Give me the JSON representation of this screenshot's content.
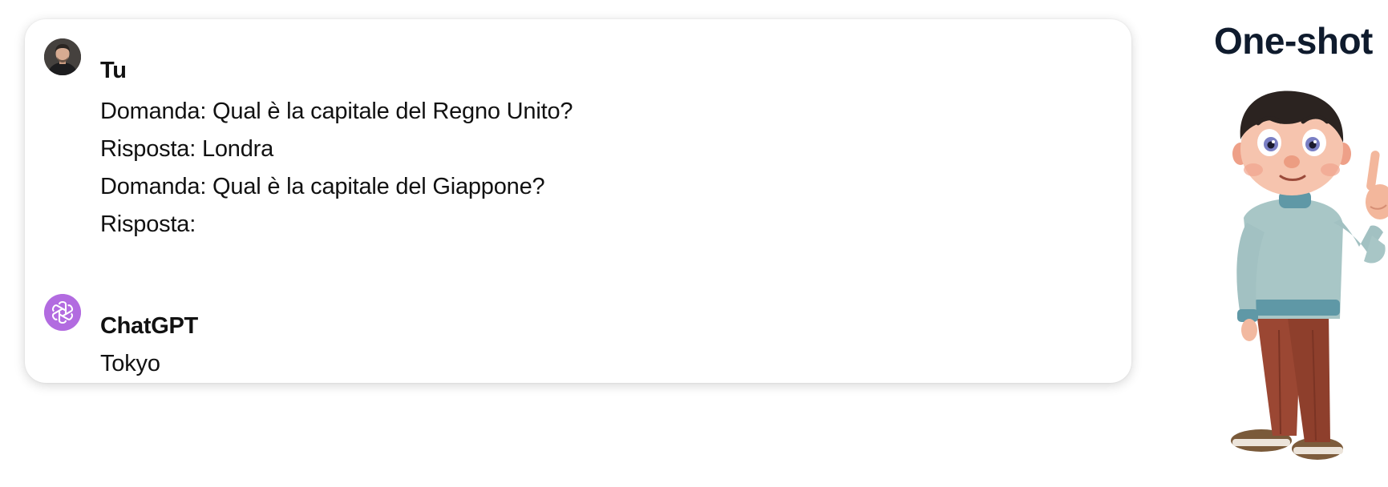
{
  "conversation": {
    "user": {
      "author": "Tu",
      "lines": [
        "Domanda: Qual è la capitale del Regno Unito?",
        "Risposta: Londra",
        "Domanda: Qual è la capitale del Giappone?",
        "Risposta:"
      ]
    },
    "assistant": {
      "author": "ChatGPT",
      "lines": [
        "Tokyo"
      ]
    }
  },
  "side_panel": {
    "title": "One-shot",
    "illustration": "cartoon-man-raising-one-finger"
  },
  "colors": {
    "assistant_avatar": "#b26be0",
    "title_text": "#0f1b2d"
  }
}
